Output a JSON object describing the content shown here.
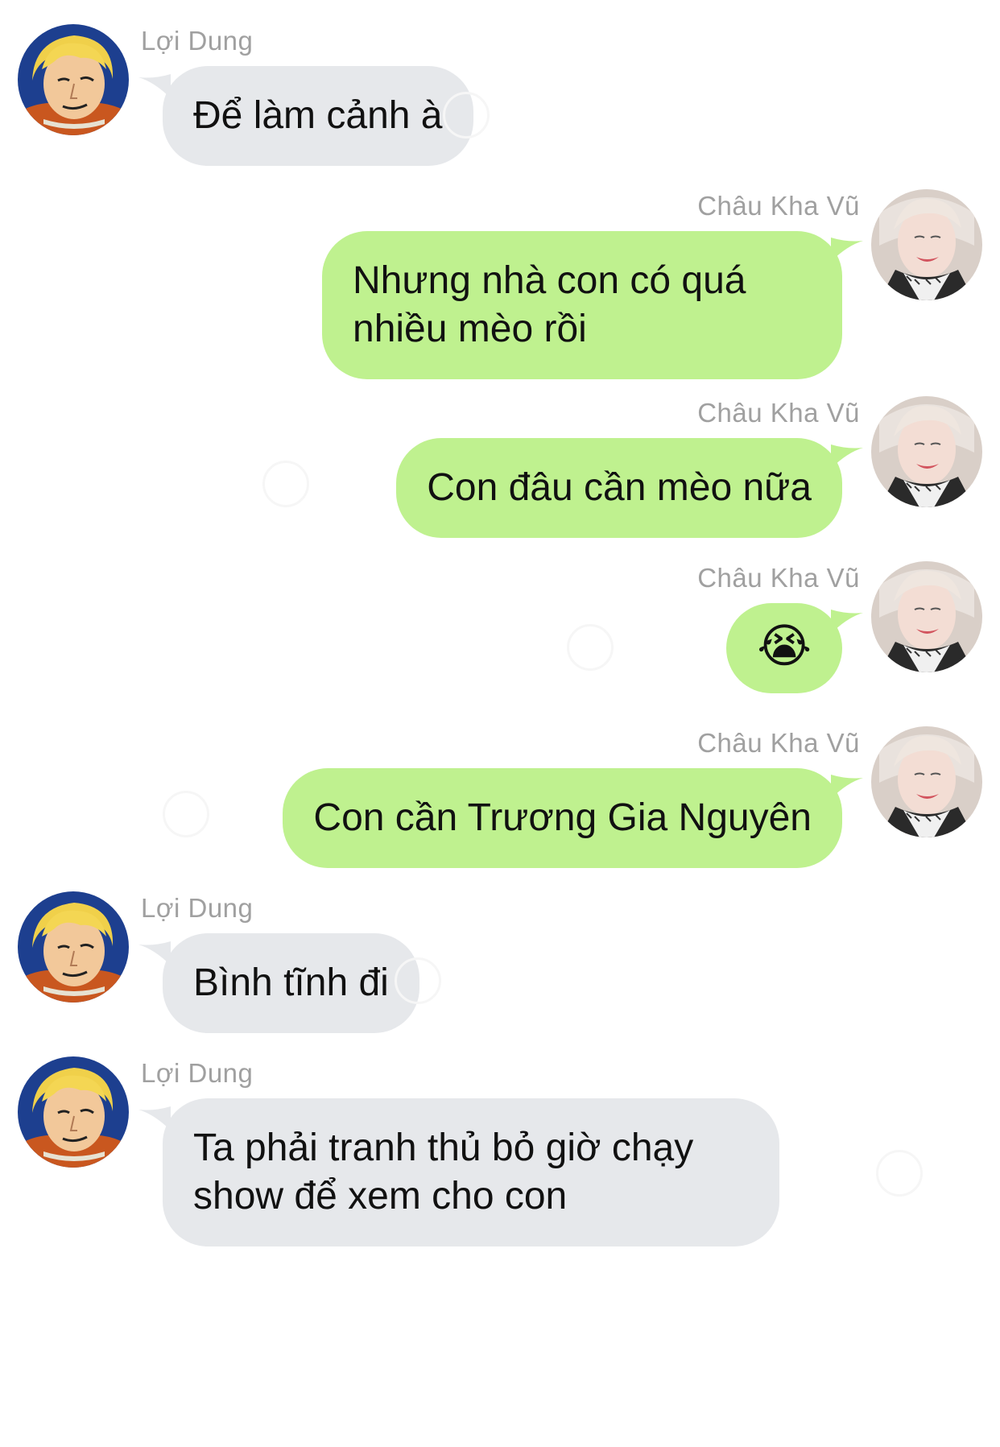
{
  "conversation": {
    "senders": {
      "left": "Lợi Dung",
      "right": "Châu Kha Vũ"
    },
    "messages": [
      {
        "sender": "Lợi Dung",
        "text": "Để làm cảnh à"
      },
      {
        "sender": "Châu Kha Vũ",
        "text": "Nhưng nhà con có quá nhiều mèo rồi"
      },
      {
        "sender": "Châu Kha Vũ",
        "text": "Con đâu cần mèo nữa"
      },
      {
        "sender": "Châu Kha Vũ",
        "text": "😭"
      },
      {
        "sender": "Châu Kha Vũ",
        "text": "Con cần Trương Gia Nguyên"
      },
      {
        "sender": "Lợi Dung",
        "text": "Bình tĩnh đi"
      },
      {
        "sender": "Lợi Dung",
        "text": "Ta phải tranh thủ bỏ giờ chạy show để xem cho con"
      }
    ]
  },
  "colors": {
    "incoming_bubble": "#e6e8eb",
    "outgoing_bubble": "#bff18f",
    "sender_name": "#a0a0a0",
    "text": "#111111"
  },
  "icons": {
    "incoming_avatar": "cartoon-blond-man-avatar",
    "outgoing_avatar": "person-photo-avatar"
  }
}
